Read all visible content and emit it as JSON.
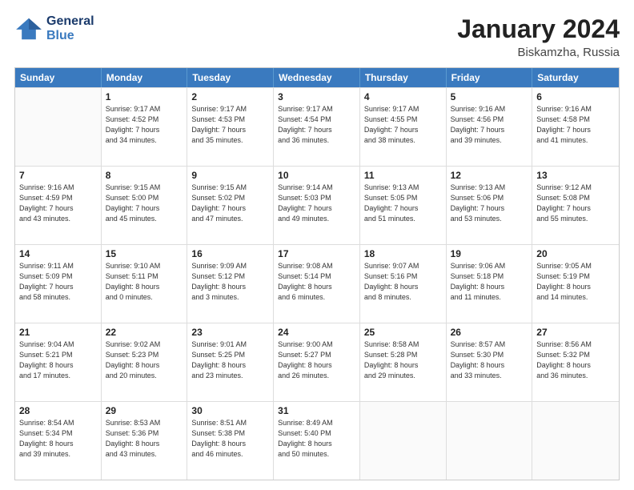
{
  "logo": {
    "line1": "General",
    "line2": "Blue"
  },
  "title": "January 2024",
  "subtitle": "Biskamzha, Russia",
  "header_days": [
    "Sunday",
    "Monday",
    "Tuesday",
    "Wednesday",
    "Thursday",
    "Friday",
    "Saturday"
  ],
  "weeks": [
    [
      {
        "day": "",
        "info": ""
      },
      {
        "day": "1",
        "info": "Sunrise: 9:17 AM\nSunset: 4:52 PM\nDaylight: 7 hours\nand 34 minutes."
      },
      {
        "day": "2",
        "info": "Sunrise: 9:17 AM\nSunset: 4:53 PM\nDaylight: 7 hours\nand 35 minutes."
      },
      {
        "day": "3",
        "info": "Sunrise: 9:17 AM\nSunset: 4:54 PM\nDaylight: 7 hours\nand 36 minutes."
      },
      {
        "day": "4",
        "info": "Sunrise: 9:17 AM\nSunset: 4:55 PM\nDaylight: 7 hours\nand 38 minutes."
      },
      {
        "day": "5",
        "info": "Sunrise: 9:16 AM\nSunset: 4:56 PM\nDaylight: 7 hours\nand 39 minutes."
      },
      {
        "day": "6",
        "info": "Sunrise: 9:16 AM\nSunset: 4:58 PM\nDaylight: 7 hours\nand 41 minutes."
      }
    ],
    [
      {
        "day": "7",
        "info": "Sunrise: 9:16 AM\nSunset: 4:59 PM\nDaylight: 7 hours\nand 43 minutes."
      },
      {
        "day": "8",
        "info": "Sunrise: 9:15 AM\nSunset: 5:00 PM\nDaylight: 7 hours\nand 45 minutes."
      },
      {
        "day": "9",
        "info": "Sunrise: 9:15 AM\nSunset: 5:02 PM\nDaylight: 7 hours\nand 47 minutes."
      },
      {
        "day": "10",
        "info": "Sunrise: 9:14 AM\nSunset: 5:03 PM\nDaylight: 7 hours\nand 49 minutes."
      },
      {
        "day": "11",
        "info": "Sunrise: 9:13 AM\nSunset: 5:05 PM\nDaylight: 7 hours\nand 51 minutes."
      },
      {
        "day": "12",
        "info": "Sunrise: 9:13 AM\nSunset: 5:06 PM\nDaylight: 7 hours\nand 53 minutes."
      },
      {
        "day": "13",
        "info": "Sunrise: 9:12 AM\nSunset: 5:08 PM\nDaylight: 7 hours\nand 55 minutes."
      }
    ],
    [
      {
        "day": "14",
        "info": "Sunrise: 9:11 AM\nSunset: 5:09 PM\nDaylight: 7 hours\nand 58 minutes."
      },
      {
        "day": "15",
        "info": "Sunrise: 9:10 AM\nSunset: 5:11 PM\nDaylight: 8 hours\nand 0 minutes."
      },
      {
        "day": "16",
        "info": "Sunrise: 9:09 AM\nSunset: 5:12 PM\nDaylight: 8 hours\nand 3 minutes."
      },
      {
        "day": "17",
        "info": "Sunrise: 9:08 AM\nSunset: 5:14 PM\nDaylight: 8 hours\nand 6 minutes."
      },
      {
        "day": "18",
        "info": "Sunrise: 9:07 AM\nSunset: 5:16 PM\nDaylight: 8 hours\nand 8 minutes."
      },
      {
        "day": "19",
        "info": "Sunrise: 9:06 AM\nSunset: 5:18 PM\nDaylight: 8 hours\nand 11 minutes."
      },
      {
        "day": "20",
        "info": "Sunrise: 9:05 AM\nSunset: 5:19 PM\nDaylight: 8 hours\nand 14 minutes."
      }
    ],
    [
      {
        "day": "21",
        "info": "Sunrise: 9:04 AM\nSunset: 5:21 PM\nDaylight: 8 hours\nand 17 minutes."
      },
      {
        "day": "22",
        "info": "Sunrise: 9:02 AM\nSunset: 5:23 PM\nDaylight: 8 hours\nand 20 minutes."
      },
      {
        "day": "23",
        "info": "Sunrise: 9:01 AM\nSunset: 5:25 PM\nDaylight: 8 hours\nand 23 minutes."
      },
      {
        "day": "24",
        "info": "Sunrise: 9:00 AM\nSunset: 5:27 PM\nDaylight: 8 hours\nand 26 minutes."
      },
      {
        "day": "25",
        "info": "Sunrise: 8:58 AM\nSunset: 5:28 PM\nDaylight: 8 hours\nand 29 minutes."
      },
      {
        "day": "26",
        "info": "Sunrise: 8:57 AM\nSunset: 5:30 PM\nDaylight: 8 hours\nand 33 minutes."
      },
      {
        "day": "27",
        "info": "Sunrise: 8:56 AM\nSunset: 5:32 PM\nDaylight: 8 hours\nand 36 minutes."
      }
    ],
    [
      {
        "day": "28",
        "info": "Sunrise: 8:54 AM\nSunset: 5:34 PM\nDaylight: 8 hours\nand 39 minutes."
      },
      {
        "day": "29",
        "info": "Sunrise: 8:53 AM\nSunset: 5:36 PM\nDaylight: 8 hours\nand 43 minutes."
      },
      {
        "day": "30",
        "info": "Sunrise: 8:51 AM\nSunset: 5:38 PM\nDaylight: 8 hours\nand 46 minutes."
      },
      {
        "day": "31",
        "info": "Sunrise: 8:49 AM\nSunset: 5:40 PM\nDaylight: 8 hours\nand 50 minutes."
      },
      {
        "day": "",
        "info": ""
      },
      {
        "day": "",
        "info": ""
      },
      {
        "day": "",
        "info": ""
      }
    ]
  ]
}
